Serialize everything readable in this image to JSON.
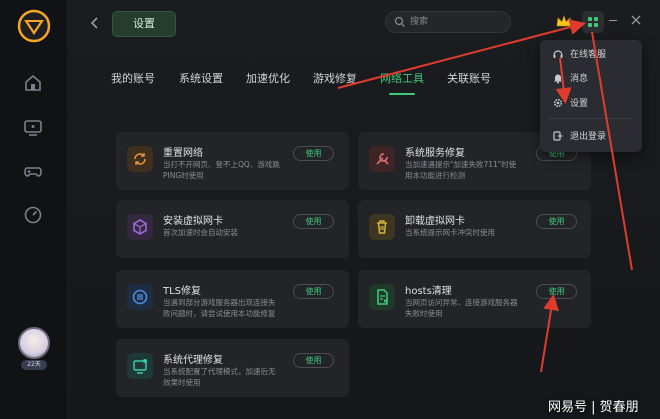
{
  "header": {
    "title": "设置",
    "search_placeholder": "搜索"
  },
  "tabs": [
    {
      "label": "我的账号",
      "active": false
    },
    {
      "label": "系统设置",
      "active": false
    },
    {
      "label": "加速优化",
      "active": false
    },
    {
      "label": "游戏修复",
      "active": false
    },
    {
      "label": "网络工具",
      "active": true
    },
    {
      "label": "关联账号",
      "active": false
    }
  ],
  "cards": [
    {
      "title": "重置网络",
      "desc": "当打不开网页、登不上QQ、游戏跳PING时使用",
      "button": "使用",
      "icon": "refresh-icon",
      "color": "#e8913a"
    },
    {
      "title": "系统服务修复",
      "desc": "当加速遇提示\"加速失败711\"时使用本功能进行检测",
      "button": "使用",
      "icon": "wrench-icon",
      "color": "#d46b6b"
    },
    {
      "title": "安装虚拟网卡",
      "desc": "首次加速时会自动安装",
      "button": "使用",
      "icon": "cube-icon",
      "color": "#9a6ad6"
    },
    {
      "title": "卸载虚拟网卡",
      "desc": "当系统提示网卡冲突时使用",
      "button": "使用",
      "icon": "trash-icon",
      "color": "#d6b13a"
    },
    {
      "title": "TLS修复",
      "desc": "当遇到部分游戏服务器出现连接失败问题时，请尝试使用本功能修复",
      "button": "使用",
      "icon": "tls-icon",
      "color": "#4a8ce0"
    },
    {
      "title": "hosts清理",
      "desc": "当网页访问异常、连接游戏服务器失败时使用",
      "button": "使用",
      "icon": "document-icon",
      "color": "#41c97a"
    },
    {
      "title": "系统代理修复",
      "desc": "当系统配置了代理模式，加速后无效果时使用",
      "button": "使用",
      "icon": "monitor-icon",
      "color": "#3ac9b0"
    }
  ],
  "dropdown": [
    {
      "label": "在线客服",
      "icon": "headset-icon"
    },
    {
      "label": "消息",
      "icon": "bell-icon"
    },
    {
      "label": "设置",
      "icon": "gear-icon"
    },
    {
      "label": "退出登录",
      "icon": "logout-icon"
    }
  ],
  "user": {
    "level_badge": "22天"
  },
  "watermark": "网易号 | 贺春朋",
  "colors": {
    "accent": "#41c97a",
    "arrow": "#e03c2e"
  }
}
